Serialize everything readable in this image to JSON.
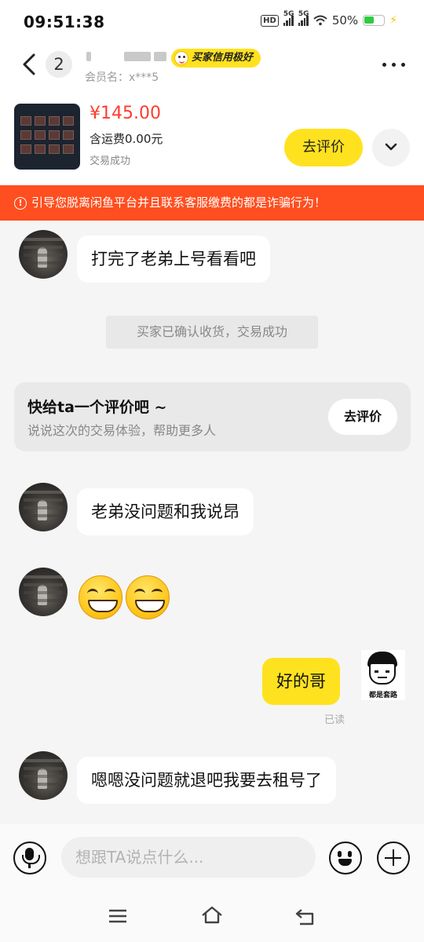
{
  "status_bar": {
    "time": "09:51:38",
    "hd_label": "HD",
    "net1": "5G",
    "net2": "5G",
    "battery_pct": "50%",
    "battery_level": 0.5
  },
  "header": {
    "unread_count": "2",
    "member_label": "会员名：x***5",
    "credit_badge": "买家信用极好"
  },
  "product": {
    "price": "¥145.00",
    "shipping": "含运费0.00元",
    "status": "交易成功",
    "rate_button": "去评价"
  },
  "warning": {
    "text": "引导您脱离闲鱼平台并且联系客服缴费的都是诈骗行为！"
  },
  "chat": {
    "messages": [
      {
        "text": "打完了老弟上号看看吧"
      },
      {
        "text": "老弟没问题和我说昂"
      },
      {
        "text": "嗯嗯没问题就退吧我要去租号了"
      }
    ],
    "system_note": "买家已确认收货，交易成功",
    "review_card": {
      "title": "快给ta一个评价吧 ~",
      "subtitle": "说说这次的交易体验，帮助更多人",
      "button": "去评价"
    },
    "my_message": "好的哥",
    "my_avatar_caption": "都是套路",
    "read_status": "已读"
  },
  "input": {
    "placeholder": "想跟TA说点什么..."
  },
  "icons": {
    "back": "back-arrow-icon",
    "more": "more-icon",
    "voice": "microphone-icon",
    "emoji": "emoji-icon",
    "plus": "plus-icon",
    "menu": "menu-icon",
    "home": "home-icon",
    "return": "return-icon"
  },
  "colors": {
    "accent_yellow": "#ffe21f",
    "warning_bg": "#ff4e1f",
    "price_red": "#ff3b30"
  }
}
